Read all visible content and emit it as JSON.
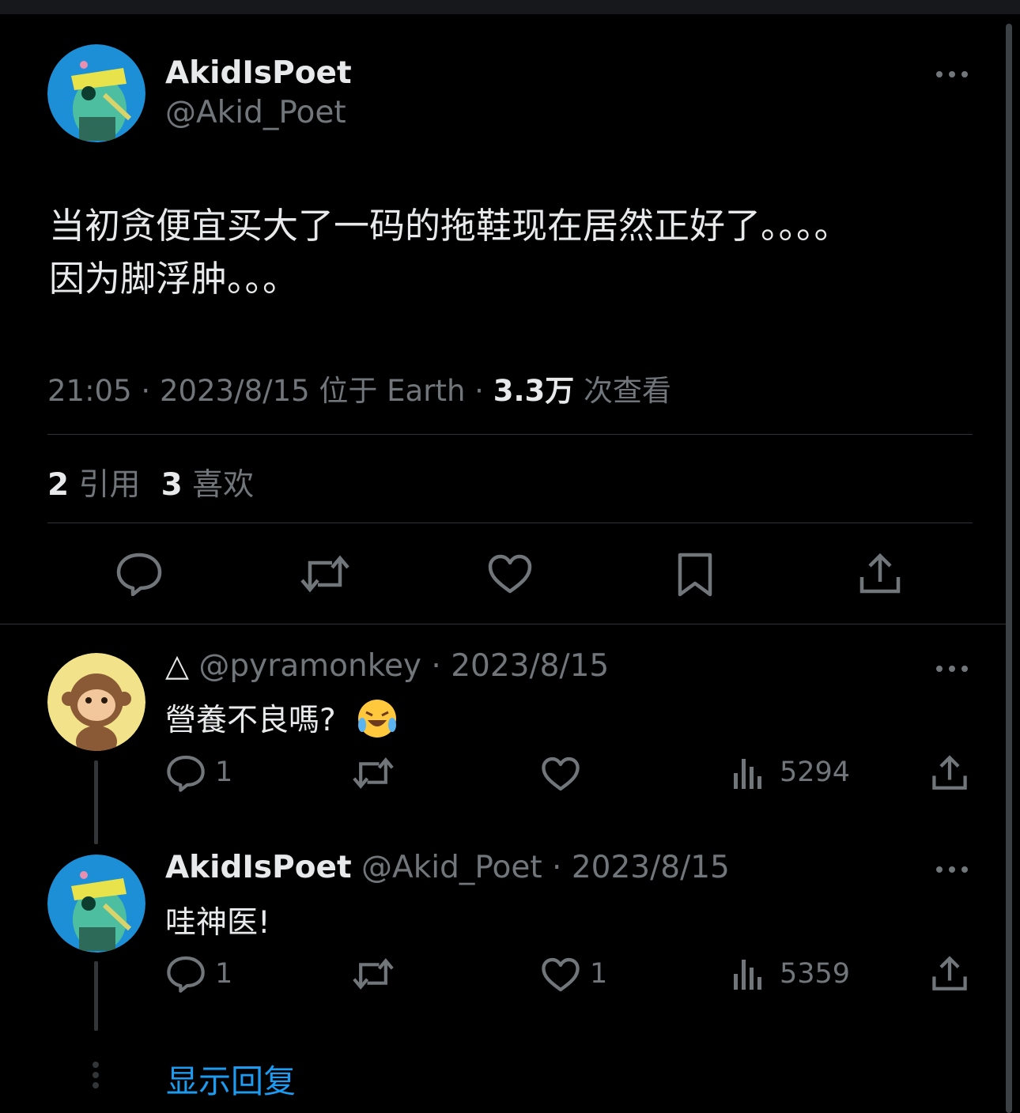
{
  "main_tweet": {
    "author_name": "AkidIsPoet",
    "author_handle": "@Akid_Poet",
    "text_line1": "当初贪便宜买大了一码的拖鞋现在居然正好了。。。。",
    "text_line2": "因为脚浮肿。。。",
    "time": "21:05",
    "date": "2023/8/15",
    "location": "位于 Earth",
    "views_count": "3.3万",
    "views_label": "次查看",
    "quotes_count": "2",
    "quotes_label": "引用",
    "likes_count": "3",
    "likes_label": "喜欢"
  },
  "replies": [
    {
      "author_prefix": "△",
      "author_handle": "@pyramonkey",
      "date": "2023/8/15",
      "text": "營養不良嗎?",
      "emoji": "😂",
      "reply_count": "1",
      "retweet_count": "",
      "like_count": "",
      "view_count": "5294"
    },
    {
      "author_name": "AkidIsPoet",
      "author_handle": "@Akid_Poet",
      "date": "2023/8/15",
      "text": "哇神医!",
      "reply_count": "1",
      "retweet_count": "",
      "like_count": "1",
      "view_count": "5359"
    }
  ],
  "show_replies_label": "显示回复",
  "icons": [
    "more-icon",
    "reply-icon",
    "retweet-icon",
    "like-icon",
    "bookmark-icon",
    "share-icon",
    "views-icon"
  ],
  "colors": {
    "background": "#000000",
    "text": "#e7e9ea",
    "muted": "#71767b",
    "link": "#1d9bf0",
    "divider": "#2f3336"
  }
}
